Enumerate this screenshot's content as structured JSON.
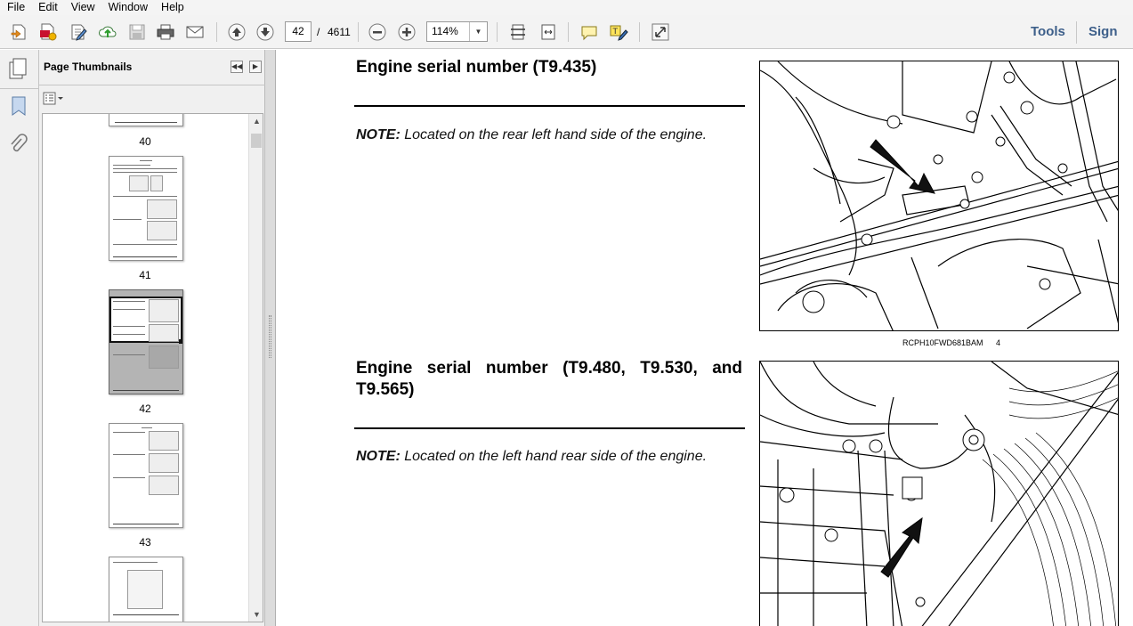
{
  "menu": [
    "File",
    "Edit",
    "View",
    "Window",
    "Help"
  ],
  "toolbar": {
    "page_current": "42",
    "page_sep": "/",
    "page_total": "4611",
    "zoom": "114%",
    "tools_label": "Tools",
    "sign_label": "Sign"
  },
  "panel": {
    "title": "Page Thumbnails",
    "thumb_labels": [
      "40",
      "41",
      "42",
      "43"
    ]
  },
  "document": {
    "section1_heading": "Engine serial number (T9.435)",
    "note_label": "NOTE:",
    "section1_note": "Located on the rear left hand side of the engine.",
    "figure1_code": "RCPH10FWD681BAM",
    "figure1_number": "4",
    "section2_heading": "Engine serial number (T9.480, T9.530, and T9.565)",
    "section2_note": "Located on the left hand rear side of the engine."
  },
  "colors": {
    "accent_link": "#3d5f8a",
    "chrome_bg": "#f0f0f0",
    "selected_thumb": "#b4b4b4"
  }
}
